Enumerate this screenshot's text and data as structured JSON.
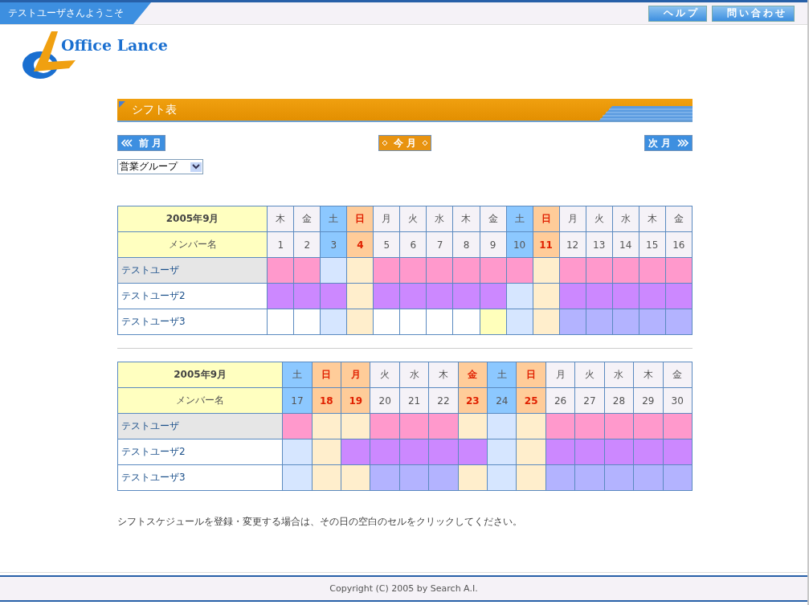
{
  "header": {
    "welcome": "テストユーザさんようこそ",
    "buttons": [
      "ヘルプ",
      "問い合わせ"
    ]
  },
  "logo": {
    "text": "Office Lance"
  },
  "section_title": "シフト表",
  "nav": {
    "prev": "前 月",
    "current": "今 月",
    "next": "次 月"
  },
  "group_select": {
    "value": "営業グループ"
  },
  "tables": [
    {
      "month": "2005年9月",
      "member_label": "メンバー名",
      "days": [
        {
          "weekday": "木",
          "date": "1",
          "kind": "weekday"
        },
        {
          "weekday": "金",
          "date": "2",
          "kind": "weekday"
        },
        {
          "weekday": "土",
          "date": "3",
          "kind": "saturday"
        },
        {
          "weekday": "日",
          "date": "4",
          "kind": "holiday"
        },
        {
          "weekday": "月",
          "date": "5",
          "kind": "weekday"
        },
        {
          "weekday": "火",
          "date": "6",
          "kind": "weekday"
        },
        {
          "weekday": "水",
          "date": "7",
          "kind": "weekday"
        },
        {
          "weekday": "木",
          "date": "8",
          "kind": "weekday"
        },
        {
          "weekday": "金",
          "date": "9",
          "kind": "weekday"
        },
        {
          "weekday": "土",
          "date": "10",
          "kind": "saturday"
        },
        {
          "weekday": "日",
          "date": "11",
          "kind": "holiday"
        },
        {
          "weekday": "月",
          "date": "12",
          "kind": "weekday"
        },
        {
          "weekday": "火",
          "date": "13",
          "kind": "weekday"
        },
        {
          "weekday": "水",
          "date": "14",
          "kind": "weekday"
        },
        {
          "weekday": "木",
          "date": "15",
          "kind": "weekday"
        },
        {
          "weekday": "金",
          "date": "16",
          "kind": "weekday"
        }
      ],
      "members": [
        {
          "name": "テストユーザ",
          "highlighted": true,
          "cells": [
            {
              "color": "#ff99cc"
            },
            {
              "color": "#ff99cc"
            },
            {
              "color": "#d6e6ff"
            },
            {
              "color": "#ffeecc"
            },
            {
              "color": "#ff99cc"
            },
            {
              "color": "#ff99cc"
            },
            {
              "color": "#ff99cc"
            },
            {
              "color": "#ff99cc"
            },
            {
              "color": "#ff99cc"
            },
            {
              "color": "#ff99cc"
            },
            {
              "color": "#ffeecc"
            },
            {
              "color": "#ff99cc"
            },
            {
              "color": "#ff99cc"
            },
            {
              "color": "#ff99cc"
            },
            {
              "color": "#ff99cc"
            },
            {
              "color": "#ff99cc"
            }
          ]
        },
        {
          "name": "テストユーザ2",
          "highlighted": false,
          "cells": [
            {
              "color": "#cc88ff"
            },
            {
              "color": "#cc88ff"
            },
            {
              "color": "#cc88ff"
            },
            {
              "color": "#ffeecc"
            },
            {
              "color": "#cc88ff"
            },
            {
              "color": "#cc88ff"
            },
            {
              "color": "#cc88ff"
            },
            {
              "color": "#cc88ff"
            },
            {
              "color": "#cc88ff"
            },
            {
              "color": "#d6e6ff"
            },
            {
              "color": "#ffeecc"
            },
            {
              "color": "#cc88ff"
            },
            {
              "color": "#cc88ff"
            },
            {
              "color": "#cc88ff"
            },
            {
              "color": "#cc88ff"
            },
            {
              "color": "#cc88ff"
            }
          ]
        },
        {
          "name": "テストユーザ3",
          "highlighted": false,
          "cells": [
            {
              "color": "#ffffff"
            },
            {
              "color": "#ffffff"
            },
            {
              "color": "#d6e6ff"
            },
            {
              "color": "#ffeecc"
            },
            {
              "color": "#ffffff"
            },
            {
              "color": "#ffffff"
            },
            {
              "color": "#ffffff"
            },
            {
              "color": "#ffffff"
            },
            {
              "color": "#ffffbb"
            },
            {
              "color": "#d6e6ff"
            },
            {
              "color": "#ffeecc"
            },
            {
              "color": "#b3b3ff"
            },
            {
              "color": "#b3b3ff"
            },
            {
              "color": "#b3b3ff"
            },
            {
              "color": "#b3b3ff"
            },
            {
              "color": "#b3b3ff"
            }
          ]
        }
      ]
    },
    {
      "month": "2005年9月",
      "member_label": "メンバー名",
      "days": [
        {
          "weekday": "土",
          "date": "17",
          "kind": "saturday"
        },
        {
          "weekday": "日",
          "date": "18",
          "kind": "holiday"
        },
        {
          "weekday": "月",
          "date": "19",
          "kind": "holiday"
        },
        {
          "weekday": "火",
          "date": "20",
          "kind": "weekday"
        },
        {
          "weekday": "水",
          "date": "21",
          "kind": "weekday"
        },
        {
          "weekday": "木",
          "date": "22",
          "kind": "weekday"
        },
        {
          "weekday": "金",
          "date": "23",
          "kind": "holiday"
        },
        {
          "weekday": "土",
          "date": "24",
          "kind": "saturday"
        },
        {
          "weekday": "日",
          "date": "25",
          "kind": "holiday"
        },
        {
          "weekday": "月",
          "date": "26",
          "kind": "weekday"
        },
        {
          "weekday": "火",
          "date": "27",
          "kind": "weekday"
        },
        {
          "weekday": "水",
          "date": "28",
          "kind": "weekday"
        },
        {
          "weekday": "木",
          "date": "29",
          "kind": "weekday"
        },
        {
          "weekday": "金",
          "date": "30",
          "kind": "weekday"
        }
      ],
      "members": [
        {
          "name": "テストユーザ",
          "highlighted": true,
          "cells": [
            {
              "color": "#ff99cc"
            },
            {
              "color": "#ffeecc"
            },
            {
              "color": "#ffeecc"
            },
            {
              "color": "#ff99cc"
            },
            {
              "color": "#ff99cc"
            },
            {
              "color": "#ff99cc"
            },
            {
              "color": "#ffeecc"
            },
            {
              "color": "#d6e6ff"
            },
            {
              "color": "#ffeecc"
            },
            {
              "color": "#ff99cc"
            },
            {
              "color": "#ff99cc"
            },
            {
              "color": "#ff99cc"
            },
            {
              "color": "#ff99cc"
            },
            {
              "color": "#ff99cc"
            }
          ]
        },
        {
          "name": "テストユーザ2",
          "highlighted": false,
          "cells": [
            {
              "color": "#d6e6ff"
            },
            {
              "color": "#ffeecc"
            },
            {
              "color": "#cc88ff"
            },
            {
              "color": "#cc88ff"
            },
            {
              "color": "#cc88ff"
            },
            {
              "color": "#cc88ff"
            },
            {
              "color": "#cc88ff"
            },
            {
              "color": "#d6e6ff"
            },
            {
              "color": "#ffeecc"
            },
            {
              "color": "#cc88ff"
            },
            {
              "color": "#cc88ff"
            },
            {
              "color": "#cc88ff"
            },
            {
              "color": "#cc88ff"
            },
            {
              "color": "#cc88ff"
            }
          ]
        },
        {
          "name": "テストユーザ3",
          "highlighted": false,
          "cells": [
            {
              "color": "#d6e6ff"
            },
            {
              "color": "#ffeecc"
            },
            {
              "color": "#ffeecc"
            },
            {
              "color": "#b3b3ff"
            },
            {
              "color": "#b3b3ff"
            },
            {
              "color": "#b3b3ff"
            },
            {
              "color": "#ffeecc"
            },
            {
              "color": "#d6e6ff"
            },
            {
              "color": "#ffeecc"
            },
            {
              "color": "#b3b3ff"
            },
            {
              "color": "#b3b3ff"
            },
            {
              "color": "#b3b3ff"
            },
            {
              "color": "#b3b3ff"
            },
            {
              "color": "#b3b3ff"
            }
          ]
        }
      ]
    }
  ],
  "note": "シフトスケジュールを登録・変更する場合は、その日の空白のセルをクリックしてください。",
  "footer": "Copyright (C) 2005 by Search A.I."
}
